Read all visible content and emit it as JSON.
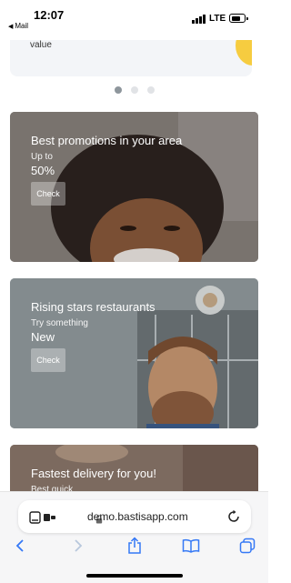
{
  "status_bar": {
    "time": "12:07",
    "back_app": "Mail",
    "network": "LTE",
    "battery_level": 0.55
  },
  "top_card": {
    "text": "value"
  },
  "carousel": {
    "pages": 3,
    "active_page": 1
  },
  "promos": [
    {
      "title": "Best promotions in your area",
      "subtitle": "Up to",
      "highlight": "50%",
      "button": "Check"
    },
    {
      "title": "Rising stars restaurants",
      "subtitle": "Try something",
      "highlight": "New",
      "button": "Check"
    },
    {
      "title": "Fastest delivery for you!",
      "subtitle": "Best quick"
    }
  ],
  "browser": {
    "url": "demo.bastisapp.com"
  },
  "colors": {
    "accent": "#3478f6",
    "top_card_yellow": "#f6cc40",
    "dot_active": "#8e969c",
    "dot_inactive": "#e1e3e6"
  },
  "icons": [
    "reader-icon",
    "lock-icon",
    "reload-icon",
    "back-icon",
    "forward-icon",
    "share-icon",
    "bookmarks-icon",
    "tabs-icon"
  ]
}
